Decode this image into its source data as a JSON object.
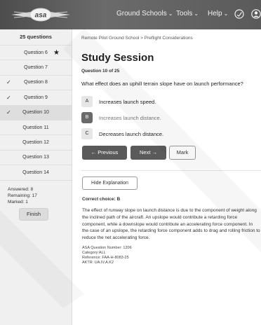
{
  "header": {
    "logo": "asa",
    "nav": [
      {
        "label": "Ground Schools",
        "icon": "chevron-down-icon"
      },
      {
        "label": "Tools",
        "icon": "chevron-down-icon"
      },
      {
        "label": "Help",
        "icon": "chevron-down-icon"
      }
    ],
    "icons": [
      "gauge-icon",
      "user-icon"
    ]
  },
  "sidebar": {
    "count_label": "25 questions",
    "items": [
      {
        "label": "Question 6",
        "checked": false,
        "starred": true,
        "active": false
      },
      {
        "label": "Question 7",
        "checked": false,
        "starred": false,
        "active": false
      },
      {
        "label": "Question 8",
        "checked": true,
        "starred": false,
        "active": false
      },
      {
        "label": "Question 9",
        "checked": true,
        "starred": false,
        "active": false
      },
      {
        "label": "Question 10",
        "checked": true,
        "starred": false,
        "active": true
      },
      {
        "label": "Question 11",
        "checked": false,
        "starred": false,
        "active": false
      },
      {
        "label": "Question 12",
        "checked": false,
        "starred": false,
        "active": false
      },
      {
        "label": "Question 13",
        "checked": false,
        "starred": false,
        "active": false
      },
      {
        "label": "Question 14",
        "checked": false,
        "starred": false,
        "active": false
      }
    ],
    "stats": {
      "answered": "Answered: 8",
      "remaining": "Remaining: 17",
      "marked": "Marked: 1"
    },
    "finish_label": "Finish"
  },
  "main": {
    "breadcrumb": "Remote Pilot Ground School  >  Preflight Considerations",
    "title": "Study Session",
    "question_number": "Question 10 of 25",
    "question": "What effect does an uphill terrain slope have on launch performance?",
    "options": [
      {
        "letter": "A",
        "text": "Increases launch speed.",
        "selected": false
      },
      {
        "letter": "B",
        "text": "Increases launch distance.",
        "selected": true
      },
      {
        "letter": "C",
        "text": "Decreases launch distance.",
        "selected": false
      }
    ],
    "previous_label": "←  Previous",
    "next_label": "Next  →",
    "mark_label": "Mark",
    "hide_label": "Hide Explanation",
    "correct_choice": "Correct choice: B",
    "explanation": "The effect of runway slope on launch distance is due to the component of weight along the inclined path of the aircraft. An upslope would contribute a retarding force component, while a downslope would contribute an accelerating force component. In the case of an upslope, the retarding force component adds to drag and rolling friction to reduce the net accelerating force.",
    "meta": {
      "question_number": "ASA Question Number: 1206",
      "category": "Category:ALL",
      "reference": "Reference: FAA-H-8083-25",
      "aktr": "AKTR: UA.IV.A.K2"
    }
  }
}
